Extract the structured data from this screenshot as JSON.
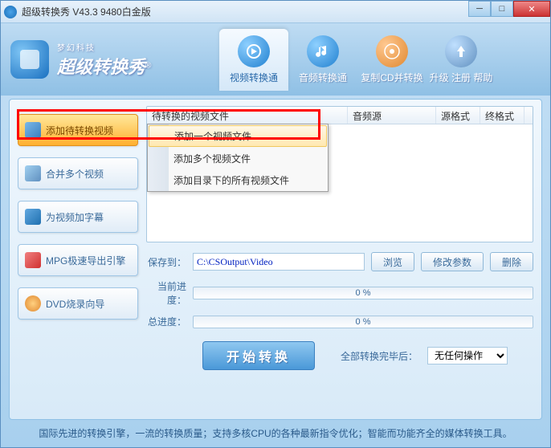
{
  "title": "超级转换秀 V43.3 9480白金版",
  "logo": {
    "sub": "梦幻科技",
    "main": "超级转换秀"
  },
  "nav": {
    "video": "视频转换通",
    "audio": "音频转换通",
    "cd": "复制CD并转换",
    "upgrade": "升级 注册 帮助"
  },
  "sidebar": {
    "add": "添加待转换视频",
    "merge": "合并多个视频",
    "subtitle": "为视频加字幕",
    "mpg": "MPG极速导出引擎",
    "dvd": "DVD烧录向导"
  },
  "menu": {
    "add_one": "添加一个视频文件",
    "add_many": "添加多个视频文件",
    "add_dir": "添加目录下的所有视频文件"
  },
  "table": {
    "col1": "待转换的视频文件",
    "col2": "音频源",
    "col3": "源格式",
    "col4": "终格式"
  },
  "path": {
    "label": "保存到：",
    "value": "C:\\CSOutput\\Video",
    "browse": "浏览",
    "params": "修改参数",
    "delete": "删除"
  },
  "progress": {
    "current_label": "当前进度：",
    "total_label": "总进度：",
    "percent": "0 %"
  },
  "action": {
    "start": "开始转换",
    "after_label": "全部转换完毕后：",
    "after_value": "无任何操作"
  },
  "status": "国际先进的转换引擎，一流的转换质量；支持多核CPU的各种最新指令优化；智能而功能齐全的媒体转换工具。"
}
